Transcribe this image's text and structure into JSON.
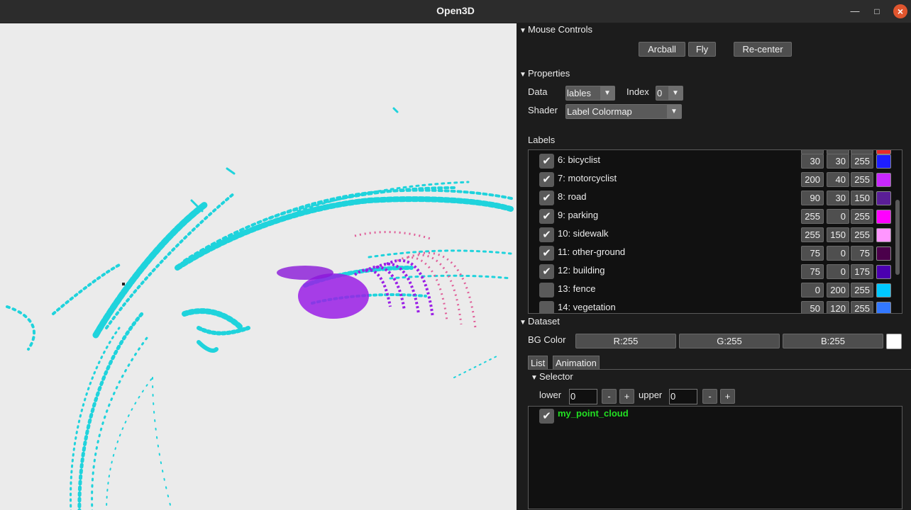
{
  "window": {
    "title": "Open3D",
    "minimize_label": "—",
    "maximize_label": "□",
    "close_label": "×"
  },
  "icons": {
    "expand": "triangle-down-icon",
    "checkmark": "checkmark-icon",
    "dropdown": "chevron-down-icon"
  },
  "mouse_controls": {
    "title": "Mouse Controls",
    "buttons": {
      "arcball": "Arcball",
      "fly": "Fly",
      "recenter": "Re-center"
    }
  },
  "properties": {
    "title": "Properties",
    "data_label": "Data",
    "data_value": "lables",
    "index_label": "Index",
    "index_value": "0",
    "shader_label": "Shader",
    "shader_value": "Label Colormap"
  },
  "labels": {
    "title": "Labels",
    "items": [
      {
        "name": "6: bicyclist",
        "checked": true,
        "r": "30",
        "g": "30",
        "b": "255",
        "color": "#1e1eff"
      },
      {
        "name": "7: motorcyclist",
        "checked": true,
        "r": "200",
        "g": "40",
        "b": "255",
        "color": "#c828ff"
      },
      {
        "name": "8: road",
        "checked": true,
        "r": "90",
        "g": "30",
        "b": "150",
        "color": "#5a1e96"
      },
      {
        "name": "9: parking",
        "checked": true,
        "r": "255",
        "g": "0",
        "b": "255",
        "color": "#ff00ff"
      },
      {
        "name": "10: sidewalk",
        "checked": true,
        "r": "255",
        "g": "150",
        "b": "255",
        "color": "#ff96ff"
      },
      {
        "name": "11: other-ground",
        "checked": true,
        "r": "75",
        "g": "0",
        "b": "75",
        "color": "#4b004b"
      },
      {
        "name": "12: building",
        "checked": true,
        "r": "75",
        "g": "0",
        "b": "175",
        "color": "#4b00af"
      },
      {
        "name": "13: fence",
        "checked": false,
        "r": "0",
        "g": "200",
        "b": "255",
        "color": "#00c8ff"
      },
      {
        "name": "14: vegetation",
        "checked": false,
        "r": "50",
        "g": "120",
        "b": "255",
        "color": "#3278ff"
      }
    ]
  },
  "dataset": {
    "title": "Dataset",
    "bg_label": "BG Color",
    "r_button": "R:255",
    "g_button": "G:255",
    "b_button": "B:255",
    "bg_color": "#ffffff",
    "tabs": {
      "list": "List",
      "animation": "Animation"
    },
    "selector": {
      "title": "Selector",
      "lower_label": "lower",
      "lower_value": "0",
      "upper_label": "upper",
      "upper_value": "0",
      "minus": "-",
      "plus": "+"
    },
    "list_items": [
      {
        "name": "my_point_cloud",
        "checked": true
      }
    ]
  },
  "colors": {
    "viewport_bg": "#ebebeb",
    "point_cyan": "#1fd3dc",
    "point_purple": "#9a1ee6",
    "point_pink": "#e0609a",
    "list_item_text": "#22e022"
  }
}
